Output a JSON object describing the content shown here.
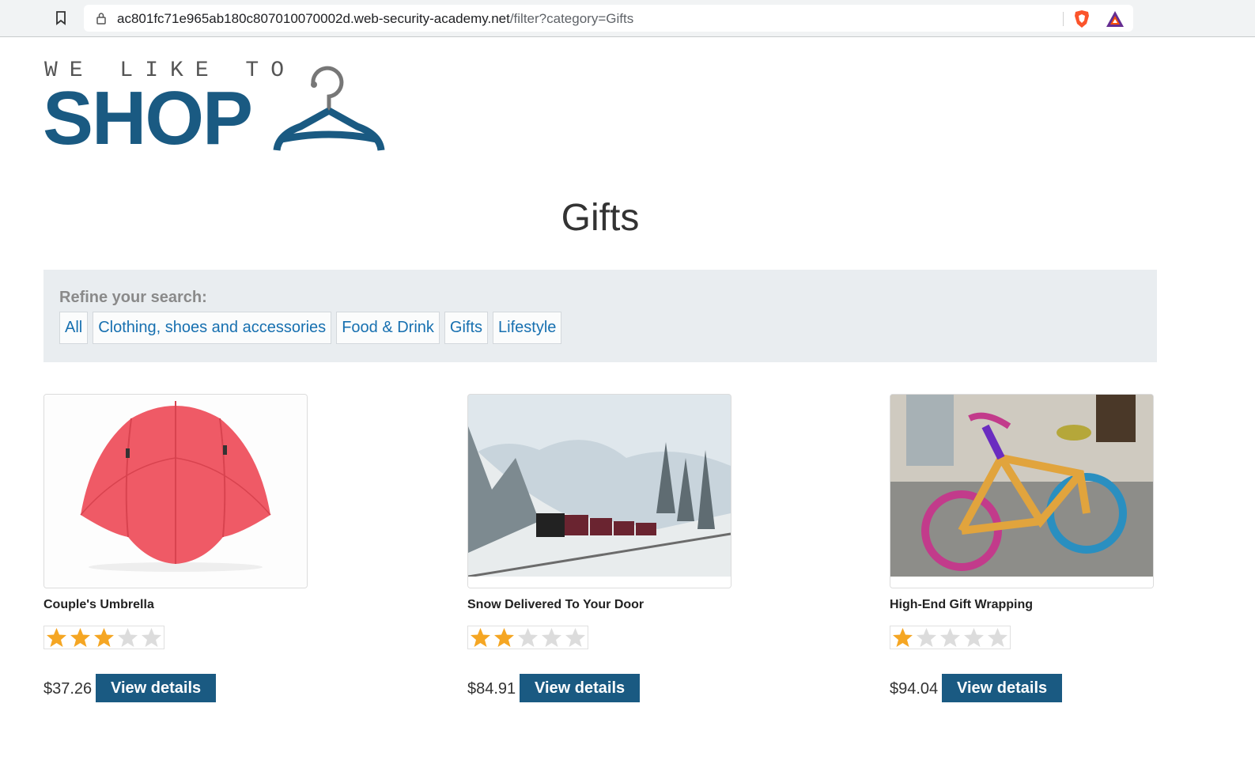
{
  "browser": {
    "url_domain": "ac801fc71e965ab180c807010070002d.web-security-academy.net",
    "url_path": "/filter?category=Gifts"
  },
  "logo": {
    "small_text": "WE LIKE TO",
    "big_text": "SHOP"
  },
  "page": {
    "title": "Gifts"
  },
  "filters": {
    "label": "Refine your search:",
    "categories": [
      "All",
      "Clothing, shoes and accessories",
      "Food & Drink",
      "Gifts",
      "Lifestyle"
    ]
  },
  "products": [
    {
      "name": "Couple's Umbrella",
      "rating": 3,
      "rating_max": 5,
      "price": "$37.26",
      "button": "View details"
    },
    {
      "name": "Snow Delivered To Your Door",
      "rating": 2,
      "rating_max": 5,
      "price": "$84.91",
      "button": "View details"
    },
    {
      "name": "High-End Gift Wrapping",
      "rating": 1,
      "rating_max": 5,
      "price": "$94.04",
      "button": "View details"
    }
  ],
  "colors": {
    "brand": "#1a5a82",
    "link": "#1770b0",
    "star_filled": "#f5a623",
    "star_empty": "#dcdcdc",
    "filter_bg": "#e9edf0"
  }
}
